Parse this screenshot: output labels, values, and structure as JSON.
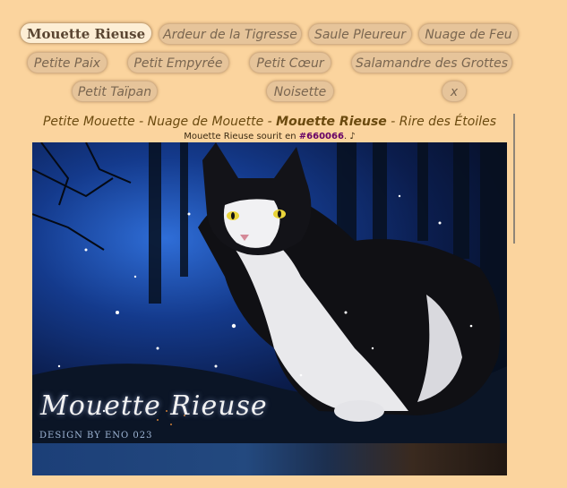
{
  "tabs": [
    {
      "label": "Mouette Rieuse",
      "active": true
    },
    {
      "label": "Ardeur de la Tigresse"
    },
    {
      "label": "Saule Pleureur"
    },
    {
      "label": "Nuage de Feu"
    },
    {
      "label": "Petite Paix"
    },
    {
      "label": "Petit Empyrée"
    },
    {
      "label": "Petit Cœur"
    },
    {
      "label": "Salamandre des Grottes"
    },
    {
      "label": "Petit Taïpan"
    },
    {
      "label": "Noisette"
    },
    {
      "label": "x"
    }
  ],
  "lineage": {
    "part1": "Petite Mouette",
    "sep": " - ",
    "part2": "Nuage de Mouette",
    "current": "Mouette Rieuse",
    "part4": "Rire des Étoiles"
  },
  "mood": {
    "prefix": "Mouette Rieuse sourit en ",
    "hex": "#660066",
    "suffix": ". ♪"
  },
  "banner": {
    "signature": "Mouette Rieuse",
    "credit": "DESIGN BY ENO 023"
  }
}
